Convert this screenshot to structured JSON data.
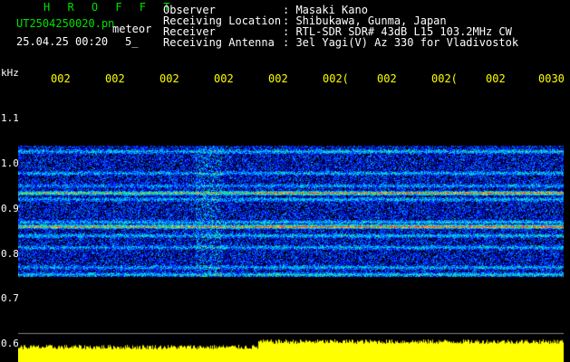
{
  "app_title": "H R O F F T",
  "file": {
    "filename": "UT2504250020.pn",
    "tag": "meteor",
    "datetime": "25.04.25 00:20",
    "extra": "5_"
  },
  "info": {
    "rows": [
      {
        "label": "Observer",
        "value": ": Masaki Kano"
      },
      {
        "label": "Receiving Location",
        "value": ": Shibukawa, Gunma, Japan"
      },
      {
        "label": "Receiver",
        "value": ": RTL-SDR SDR# 43dB L15 103.2MHz CW"
      },
      {
        "label": "Receiving Antenna",
        "value": ": 3el Yagi(V) Az 330 for Vladivostok"
      }
    ]
  },
  "axis": {
    "unit": "kHz",
    "time_ticks": [
      "002",
      "002",
      "002",
      "002",
      "002",
      "002(",
      "002",
      "002(",
      "002",
      "0030"
    ],
    "freq_ticks": [
      "1.1",
      "1.0",
      "0.9",
      "0.8",
      "0.7",
      "0.6"
    ]
  },
  "colors": {
    "background": "#000000",
    "header_text": "#ffffff",
    "title_green": "#00e000",
    "tick_yellow": "#ffff00",
    "footer_yellow": "#ffff00",
    "spectro_low": "#000080",
    "spectro_mid": "#00c0ff",
    "spectro_high": "#ff3030"
  }
}
